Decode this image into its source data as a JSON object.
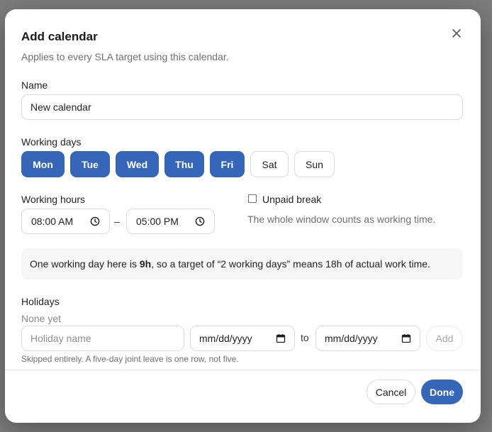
{
  "dialog": {
    "title": "Add calendar",
    "subtitle": "Applies to every SLA target using this calendar.",
    "close_icon": "close-icon"
  },
  "name": {
    "label": "Name",
    "value": "New calendar"
  },
  "working_days": {
    "label": "Working days",
    "days": [
      {
        "label": "Mon",
        "selected": true
      },
      {
        "label": "Tue",
        "selected": true
      },
      {
        "label": "Wed",
        "selected": true
      },
      {
        "label": "Thu",
        "selected": true
      },
      {
        "label": "Fri",
        "selected": true
      },
      {
        "label": "Sat",
        "selected": false
      },
      {
        "label": "Sun",
        "selected": false
      }
    ]
  },
  "working_hours": {
    "label": "Working hours",
    "start": "08:00 AM",
    "separator": "–",
    "end": "05:00 PM",
    "clock_icon": "clock-icon"
  },
  "unpaid_break": {
    "label": "Unpaid break",
    "checked": false,
    "help": "The whole window counts as working time."
  },
  "info": {
    "prefix": "One working day here is ",
    "hours": "9h",
    "suffix": ", so a target of “2 working days” means 18h of actual work time."
  },
  "holidays": {
    "label": "Holidays",
    "empty_text": "None yet",
    "name_placeholder": "Holiday name",
    "date_from": "mm/dd/yyyy",
    "to_label": "to",
    "date_to": "mm/dd/yyyy",
    "add_label": "Add",
    "help": "Skipped entirely. A five-day joint leave is one row, not five.",
    "calendar_icon": "calendar-icon"
  },
  "footer": {
    "cancel_label": "Cancel",
    "done_label": "Done"
  },
  "colors": {
    "accent": "#3566b8",
    "backdrop": "#7d7d7d"
  }
}
